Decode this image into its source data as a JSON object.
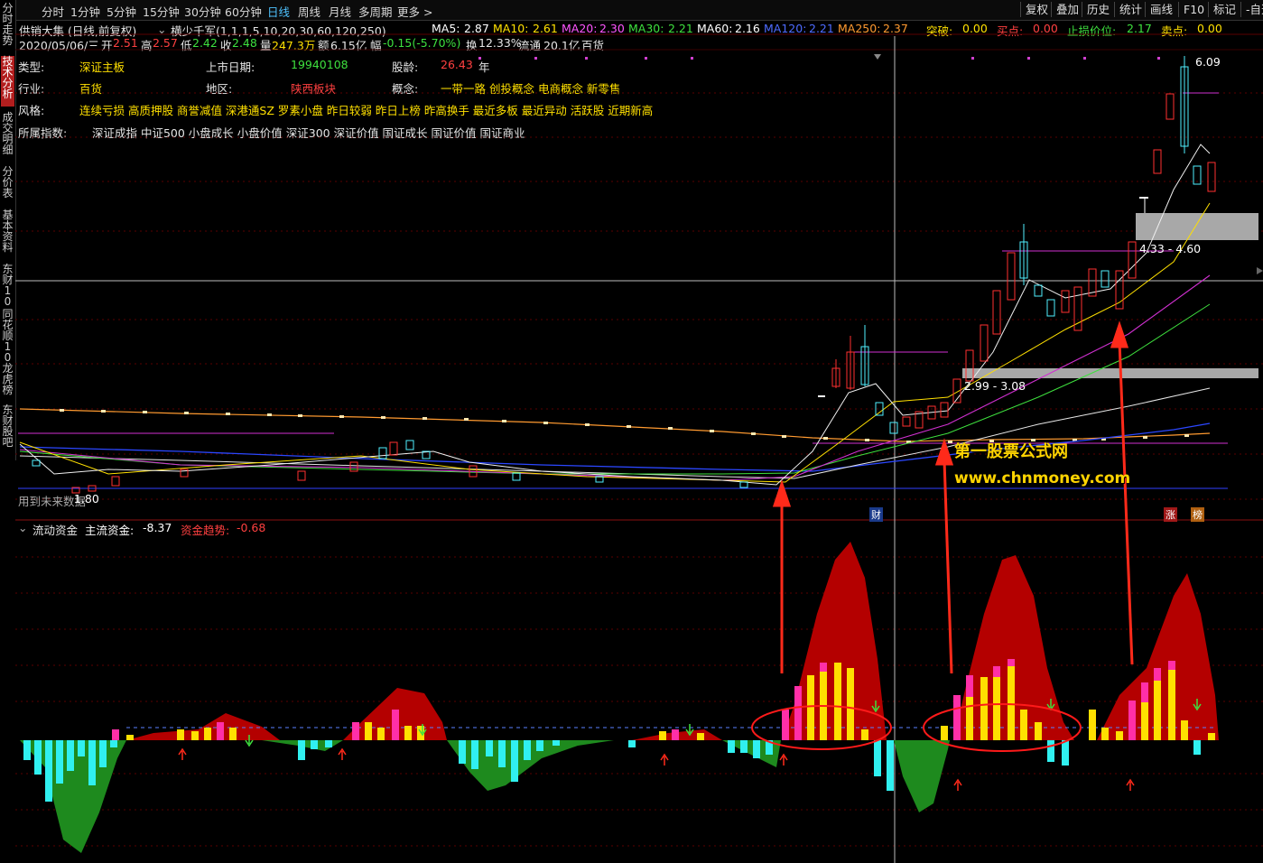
{
  "tabs": [
    {
      "label": "分时"
    },
    {
      "label": "1分钟"
    },
    {
      "label": "5分钟"
    },
    {
      "label": "15分钟"
    },
    {
      "label": "30分钟"
    },
    {
      "label": "60分钟"
    },
    {
      "label": "日线"
    },
    {
      "label": "周线"
    },
    {
      "label": "月线"
    },
    {
      "label": "多周期"
    },
    {
      "label": "更多 >"
    }
  ],
  "right_buttons": [
    {
      "label": "复权"
    },
    {
      "label": "叠加"
    },
    {
      "label": "历史"
    },
    {
      "label": "统计"
    },
    {
      "label": "画线"
    },
    {
      "label": "F10"
    },
    {
      "label": "标记"
    },
    {
      "label": "-自选"
    }
  ],
  "sidebar": [
    {
      "label": "分时走势"
    },
    {
      "label": "技术分析"
    },
    {
      "label": "成交明细"
    },
    {
      "label": "分价表"
    },
    {
      "label": "基本资料"
    },
    {
      "label": "东财10"
    },
    {
      "label": "同花顺10"
    },
    {
      "label": "龙虎榜"
    },
    {
      "label": "东财股吧"
    }
  ],
  "header": {
    "stock_title": "供销大集 (日线,前复权)",
    "indicator_name": "横少千军(1,1,1,5,10,20,30,60,120,250)",
    "ma": {
      "ma5_label": "MA5:",
      "ma5": "2.87",
      "ma10_label": "MA10:",
      "ma10": "2.61",
      "ma20_label": "MA20:",
      "ma20": "2.30",
      "ma30_label": "MA30:",
      "ma30": "2.21",
      "ma60_label": "MA60:",
      "ma60": "2.16",
      "ma120_label": "MA120:",
      "ma120": "2.21",
      "ma250_label": "MA250:",
      "ma250": "2.37"
    },
    "signals": {
      "tupo_label": "突破:",
      "tupo": "0.00",
      "maidian_label": "买点:",
      "maidian": "0.00",
      "zhisun_label": "止损价位:",
      "zhisun": "2.17",
      "maichu_label": "卖点:",
      "maichu": "0.00"
    },
    "quote": {
      "date": "2020/05/06/三",
      "open_label": "开",
      "open": "2.51",
      "high_label": "高",
      "high": "2.57",
      "low_label": "低",
      "low": "2.42",
      "close_label": "收",
      "close": "2.48",
      "vol_label": "量",
      "vol": "247.3万",
      "amount_label": "额",
      "amount": "6.15亿",
      "change_label": "幅",
      "change": "-0.15(-5.70%)",
      "turnover_label": "换",
      "turnover": "12.33%",
      "float_label": "流通",
      "float": "20.1亿",
      "industry_tag": "百货"
    }
  },
  "info": {
    "type_label": "类型:",
    "type": "深证主板",
    "listing_label": "上市日期:",
    "listing": "19940108",
    "age_label": "股龄:",
    "age": "26.43",
    "age_unit": "年",
    "industry_label": "行业:",
    "industry": "百货",
    "region_label": "地区:",
    "region": "陕西板块",
    "concept_label": "概念:",
    "concepts": "一带一路  创投概念  电商概念  新零售",
    "style_label": "风格:",
    "styles": "连续亏损 高质押股 商誉减值 深港通SZ 罗素小盘 昨日较弱 昨日上榜 昨高换手 最近多板 最近异动 活跃股 近期新高",
    "index_label": "所属指数:",
    "indexes": "深证成指 中证500 小盘成长 小盘价值 深证300 深证价值 国证成长 国证价值 国证商业"
  },
  "chart_labels": {
    "price_high": "6.09",
    "zone_upper": "4.33 - 4.60",
    "zone_lower": "2.99 - 3.08",
    "price_low": "1.80",
    "low_note": "用到未来数据",
    "badge_cai": "财",
    "badge_zhang": "涨",
    "badge_bang": "榜"
  },
  "lower_panel": {
    "name": "流动资金",
    "main_label": "主流资金:",
    "main_value": "-8.37",
    "trend_label": "资金趋势:",
    "trend_value": "-0.68"
  },
  "watermark": {
    "line1": "第一股票公式网",
    "line2": "www.chnmoney.com"
  },
  "colors": {
    "background": "#000000",
    "up_candle": "#ff3030",
    "down_candle": "#4ff0ff",
    "fund_red": "#b40000",
    "fund_green": "#1e8a1e",
    "bar_yellow": "#ffe000",
    "bar_magenta": "#ff2fa8",
    "bar_cyan": "#30f0f0",
    "arrow_red": "#ff2a1a",
    "zone_gray": "#a8a8a8"
  }
}
